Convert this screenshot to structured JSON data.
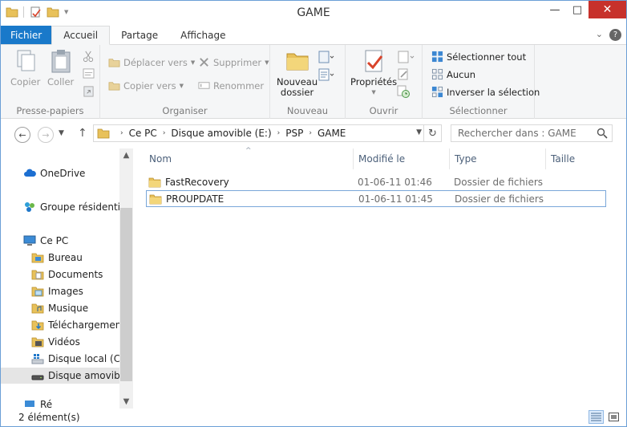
{
  "window": {
    "title": "GAME"
  },
  "titlebar_buttons": {
    "minimize": "—",
    "maximize": "□",
    "close": "✕"
  },
  "ribbon_tabs": {
    "fichier": "Fichier",
    "accueil": "Accueil",
    "partage": "Partage",
    "affichage": "Affichage"
  },
  "ribbon": {
    "presse_papiers": {
      "label": "Presse-papiers",
      "copier": "Copier",
      "coller": "Coller"
    },
    "organiser": {
      "label": "Organiser",
      "deplacer_vers": "Déplacer vers",
      "copier_vers": "Copier vers",
      "supprimer": "Supprimer",
      "renommer": "Renommer"
    },
    "nouveau": {
      "label": "Nouveau",
      "nouveau_dossier_l1": "Nouveau",
      "nouveau_dossier_l2": "dossier"
    },
    "ouvrir": {
      "label": "Ouvrir",
      "proprietes": "Propriétés"
    },
    "selectionner": {
      "label": "Sélectionner",
      "selectionner_tout": "Sélectionner tout",
      "aucun": "Aucun",
      "inverser": "Inverser la sélection"
    }
  },
  "address": {
    "crumbs": [
      "Ce PC",
      "Disque amovible (E:)",
      "PSP",
      "GAME"
    ],
    "search_placeholder": "Rechercher dans : GAME"
  },
  "nav_pane": {
    "onedrive": "OneDrive",
    "groupe": "Groupe résidentiel",
    "ce_pc": "Ce PC",
    "items": [
      "Bureau",
      "Documents",
      "Images",
      "Musique",
      "Téléchargements",
      "Vidéos",
      "Disque local (C:)",
      "Disque amovible"
    ],
    "truncated_next": "Ré"
  },
  "columns": {
    "name": "Nom",
    "modified": "Modifié le",
    "type": "Type",
    "size": "Taille"
  },
  "files": [
    {
      "name": "FastRecovery",
      "modified": "01-06-11 01:46",
      "type": "Dossier de fichiers"
    },
    {
      "name": "PROUPDATE",
      "modified": "01-06-11 01:45",
      "type": "Dossier de fichiers"
    }
  ],
  "status": {
    "count": "2 élément(s)"
  },
  "colors": {
    "accent": "#1979ca",
    "close": "#c7312b",
    "folder": "#e8c15a"
  }
}
